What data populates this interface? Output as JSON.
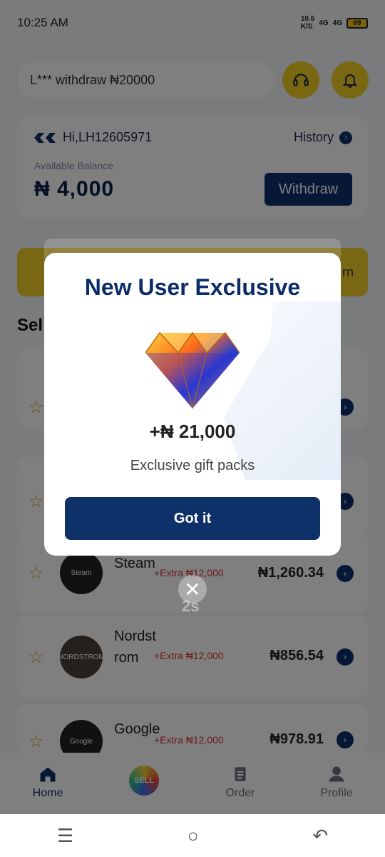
{
  "status_bar": {
    "time": "10:25 AM",
    "speed_top": "10.6",
    "speed_bottom": "K/S",
    "network_1": "4G",
    "network_2": "4G",
    "battery": "69"
  },
  "header": {
    "ticker": "L*** withdraw ₦20000",
    "support_icon": "headset-icon",
    "notification_icon": "bell-icon"
  },
  "balance_card": {
    "greeting": "Hi,LH12605971",
    "history_label": "History",
    "available_label": "Available Balance",
    "balance": "₦ 4,000",
    "withdraw_label": "Withdraw"
  },
  "promo_banner": {
    "visible_text": "rn"
  },
  "section": {
    "title_visible": "Sel"
  },
  "list_items": [
    {
      "name": "Steam",
      "avatar_text": "Steam",
      "extra": "+Extra ₦12,000",
      "price": "₦1,260.34"
    },
    {
      "name": "Nordstrom",
      "avatar_text": "NORDSTROM",
      "extra": "+Extra ₦12,000",
      "price": "₦856.54"
    },
    {
      "name": "Google",
      "avatar_text": "Google",
      "extra": "+Extra ₦12,000",
      "price": "₦978.91"
    }
  ],
  "tabs": [
    {
      "label": "Home",
      "icon": "home-icon"
    },
    {
      "label": "",
      "icon": "sell-icon",
      "badge_text": "SELL"
    },
    {
      "label": "Order",
      "icon": "clipboard-icon"
    },
    {
      "label": "Profile",
      "icon": "user-icon"
    }
  ],
  "modal": {
    "title": "New User Exclusive",
    "amount": "+₦ 21,000",
    "subtitle": "Exclusive gift packs",
    "button": "Got it",
    "countdown": "2s"
  },
  "system_nav": {
    "menu_icon": "menu-icon",
    "home_icon": "circle-home-icon",
    "back_icon": "back-icon"
  },
  "colors": {
    "primary": "#0f3169",
    "accent_yellow": "#f4cf22",
    "extra_red": "#d33333"
  }
}
